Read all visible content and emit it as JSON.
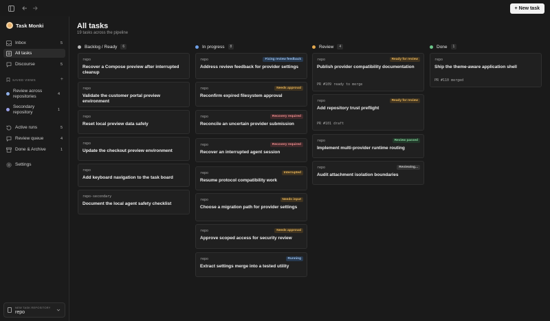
{
  "toolbar": {
    "new_task_label": "New task",
    "new_task_plus": "+",
    "sidebar_toggle_icon": "sidebar-toggle-icon",
    "back_icon": "arrow-left-icon",
    "forward_icon": "arrow-right-icon"
  },
  "sidebar": {
    "brand": "Task Monki",
    "nav": [
      {
        "label": "Inbox",
        "count": "5",
        "icon": "inbox-icon"
      },
      {
        "label": "All tasks",
        "count": "",
        "icon": "list-icon",
        "active": true
      },
      {
        "label": "Discourse",
        "count": "5",
        "icon": "chat-icon"
      }
    ],
    "saved_views_label": "SAVED VIEWS",
    "saved_views_plus": "+",
    "views": [
      {
        "label": "Review across repositories",
        "count": "4",
        "color": "#8fb0e8"
      },
      {
        "label": "Secondary repository",
        "count": "1",
        "color": "#9aa0e8"
      }
    ],
    "status_items": [
      {
        "label": "Active runs",
        "count": "5",
        "icon": "runs-icon"
      },
      {
        "label": "Review queue",
        "count": "4",
        "icon": "review-icon"
      },
      {
        "label": "Done & Archive",
        "count": "1",
        "icon": "archive-icon"
      }
    ],
    "settings_label": "Settings",
    "repo_picker": {
      "label": "NEW TASK REPOSITORY",
      "value": "repo"
    }
  },
  "main": {
    "title": "All tasks",
    "subtitle": "19 tasks across the pipeline"
  },
  "columns": [
    {
      "name": "Backlog / Ready",
      "count": "6",
      "color": "#b9b9b9",
      "cards": [
        {
          "repo": "repo",
          "title": "Recover a Compose preview after interrupted cleanup",
          "badge": "",
          "badge_class": ""
        },
        {
          "repo": "repo",
          "title": "Validate the customer portal preview environment",
          "badge": "",
          "badge_class": ""
        },
        {
          "repo": "repo",
          "title": "Reset local preview data safely",
          "badge": "",
          "badge_class": ""
        },
        {
          "repo": "repo",
          "title": "Update the checkout preview environment",
          "badge": "",
          "badge_class": ""
        },
        {
          "repo": "repo",
          "title": "Add keyboard navigation to the task board",
          "badge": "",
          "badge_class": ""
        },
        {
          "repo": "repo-secondary",
          "title": "Document the local agent safety checklist",
          "badge": "",
          "badge_class": ""
        }
      ]
    },
    {
      "name": "In progress",
      "count": "8",
      "color": "#6e9fe6",
      "cards": [
        {
          "repo": "repo",
          "title": "Address review feedback for provider settings",
          "badge": "Fixing review feedback",
          "badge_class": "b-blue"
        },
        {
          "repo": "repo",
          "title": "Reconfirm expired filesystem approval",
          "badge": "Needs approval",
          "badge_class": "b-amber"
        },
        {
          "repo": "repo",
          "title": "Reconcile an uncertain provider submission",
          "badge": "Recovery required",
          "badge_class": "b-red"
        },
        {
          "repo": "repo",
          "title": "Recover an interrupted agent session",
          "badge": "Recovery required",
          "badge_class": "b-red"
        },
        {
          "repo": "repo",
          "title": "Resume protocol compatibility work",
          "badge": "Interrupted",
          "badge_class": "b-amber"
        },
        {
          "repo": "repo",
          "title": "Choose a migration path for provider settings",
          "badge": "Needs input",
          "badge_class": "b-amber"
        },
        {
          "repo": "repo",
          "title": "Approve scoped access for security review",
          "badge": "Needs approval",
          "badge_class": "b-amber"
        },
        {
          "repo": "repo",
          "title": "Extract settings merge into a tested utility",
          "badge": "Running",
          "badge_class": "b-blue"
        }
      ]
    },
    {
      "name": "Review",
      "count": "4",
      "color": "#e3a84e",
      "cards": [
        {
          "repo": "repo",
          "title": "Publish provider compatibility documentation",
          "badge": "Ready for review",
          "badge_class": "b-amber",
          "pr": "PR #109 ready to merge"
        },
        {
          "repo": "repo",
          "title": "Add repository trust preflight",
          "badge": "Ready for review",
          "badge_class": "b-amber",
          "pr": "PR #101 draft"
        },
        {
          "repo": "repo",
          "title": "Implement multi-provider runtime routing",
          "badge": "Review passed",
          "badge_class": "b-green"
        },
        {
          "repo": "repo",
          "title": "Audit attachment isolation boundaries",
          "badge": "Reviewing...",
          "badge_class": "b-gray"
        }
      ]
    },
    {
      "name": "Done",
      "count": "1",
      "color": "#6cc58a",
      "cards": [
        {
          "repo": "repo",
          "title": "Ship the theme-aware application shell",
          "badge": "",
          "badge_class": "",
          "pr": "PR #110 merged"
        }
      ]
    }
  ]
}
